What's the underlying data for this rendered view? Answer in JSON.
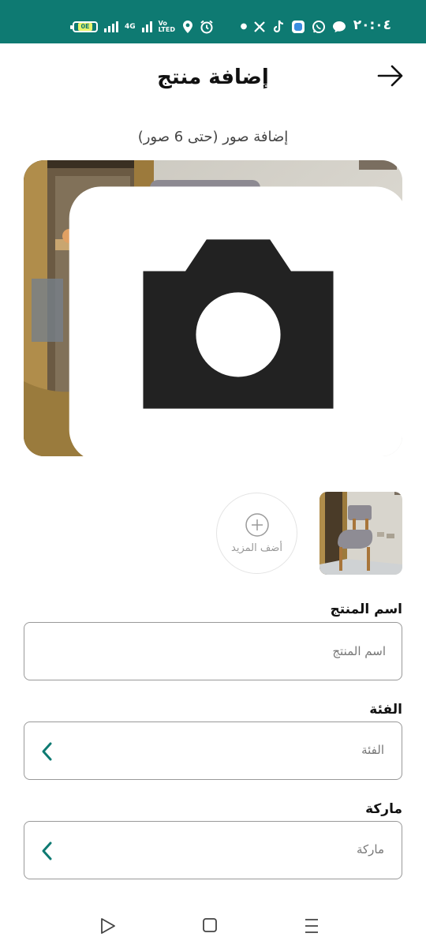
{
  "status_bar": {
    "time": "٢٠:٠٤",
    "battery": "0E",
    "network": "4G",
    "volte": "Vo LTED",
    "icons": [
      "battery-icon",
      "signal-icon",
      "signal-4g-icon",
      "volte-icon",
      "location-icon",
      "alarm-icon",
      "dot-icon",
      "x-icon",
      "tiktok-icon",
      "app-icon",
      "whatsapp-icon",
      "chat-icon"
    ]
  },
  "header": {
    "title": "إضافة منتج",
    "back_icon": "arrow-right-icon"
  },
  "photos": {
    "hint": "إضافة صور (حتى 6 صور)",
    "add_more_label": "أضف المزيد",
    "count": 1
  },
  "form": {
    "name": {
      "label": "اسم المنتج",
      "placeholder": "اسم المنتج",
      "value": ""
    },
    "category": {
      "label": "الفئة",
      "value": "الفئة"
    },
    "brand": {
      "label": "ماركة",
      "value": "ماركة"
    }
  },
  "colors": {
    "status_bar": "#0e7a72",
    "accent": "#0e7a72",
    "border": "#999999"
  },
  "nav_bar": {
    "icons": [
      "back-triangle-icon",
      "home-square-icon",
      "menu-lines-icon"
    ]
  }
}
